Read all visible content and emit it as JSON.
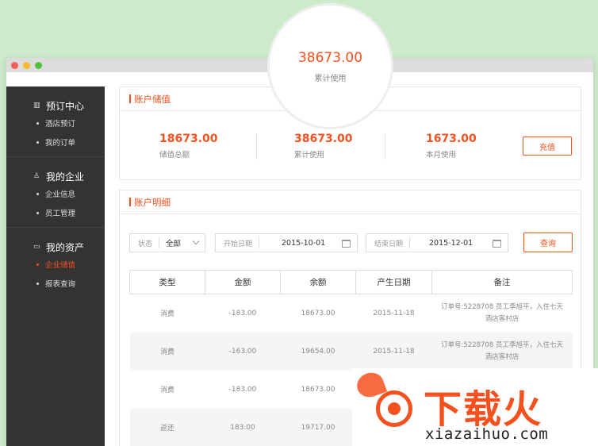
{
  "bubble": {
    "value": "38673.00",
    "label": "累计使用"
  },
  "sidebar": {
    "groups": [
      {
        "title": "预订中心",
        "icon": "building-icon",
        "items": [
          {
            "label": "酒店预订",
            "active": false
          },
          {
            "label": "我的订单",
            "active": false
          }
        ]
      },
      {
        "title": "我的企业",
        "icon": "user-icon",
        "items": [
          {
            "label": "企业信息",
            "active": false
          },
          {
            "label": "员工管理",
            "active": false
          }
        ]
      },
      {
        "title": "我的资产",
        "icon": "wallet-icon",
        "items": [
          {
            "label": "企业储值",
            "active": true
          },
          {
            "label": "报表查询",
            "active": false
          }
        ]
      }
    ]
  },
  "stored_value": {
    "title": "账户储值",
    "stats": [
      {
        "value": "18673.00",
        "label": "储值总额"
      },
      {
        "value": "38673.00",
        "label": "累计使用"
      },
      {
        "value": "1673.00",
        "label": "本月使用"
      }
    ],
    "recharge_label": "充值"
  },
  "details": {
    "title": "账户明细",
    "filters": {
      "status_label": "状态",
      "status_value": "全部",
      "start_label": "开始日期",
      "start_value": "2015-10-01",
      "end_label": "结束日期",
      "end_value": "2015-12-01",
      "query_label": "查询"
    },
    "columns": [
      "类型",
      "金额",
      "余额",
      "产生日期",
      "备注"
    ],
    "rows": [
      {
        "type": "消费",
        "amount": "-183.00",
        "balance": "18673.00",
        "date": "2015-11-18",
        "note": "订单号:5228708 员工李旭平，入住七天酒店客村店"
      },
      {
        "type": "消费",
        "amount": "-163.00",
        "balance": "19654.00",
        "date": "2015-11-18",
        "note": "订单号:5228708 员工李旭平，入住七天酒店客村店"
      },
      {
        "type": "消费",
        "amount": "-183.00",
        "balance": "18673.00",
        "date": "",
        "note": ""
      },
      {
        "type": "返还",
        "amount": "183.00",
        "balance": "19717.00",
        "date": "",
        "note": ""
      }
    ]
  },
  "watermark": {
    "title": "下载火",
    "url": "xiazaihuo.com"
  },
  "colors": {
    "accent": "#f4511e",
    "sidebar": "#333333",
    "background": "#cdeacb"
  }
}
